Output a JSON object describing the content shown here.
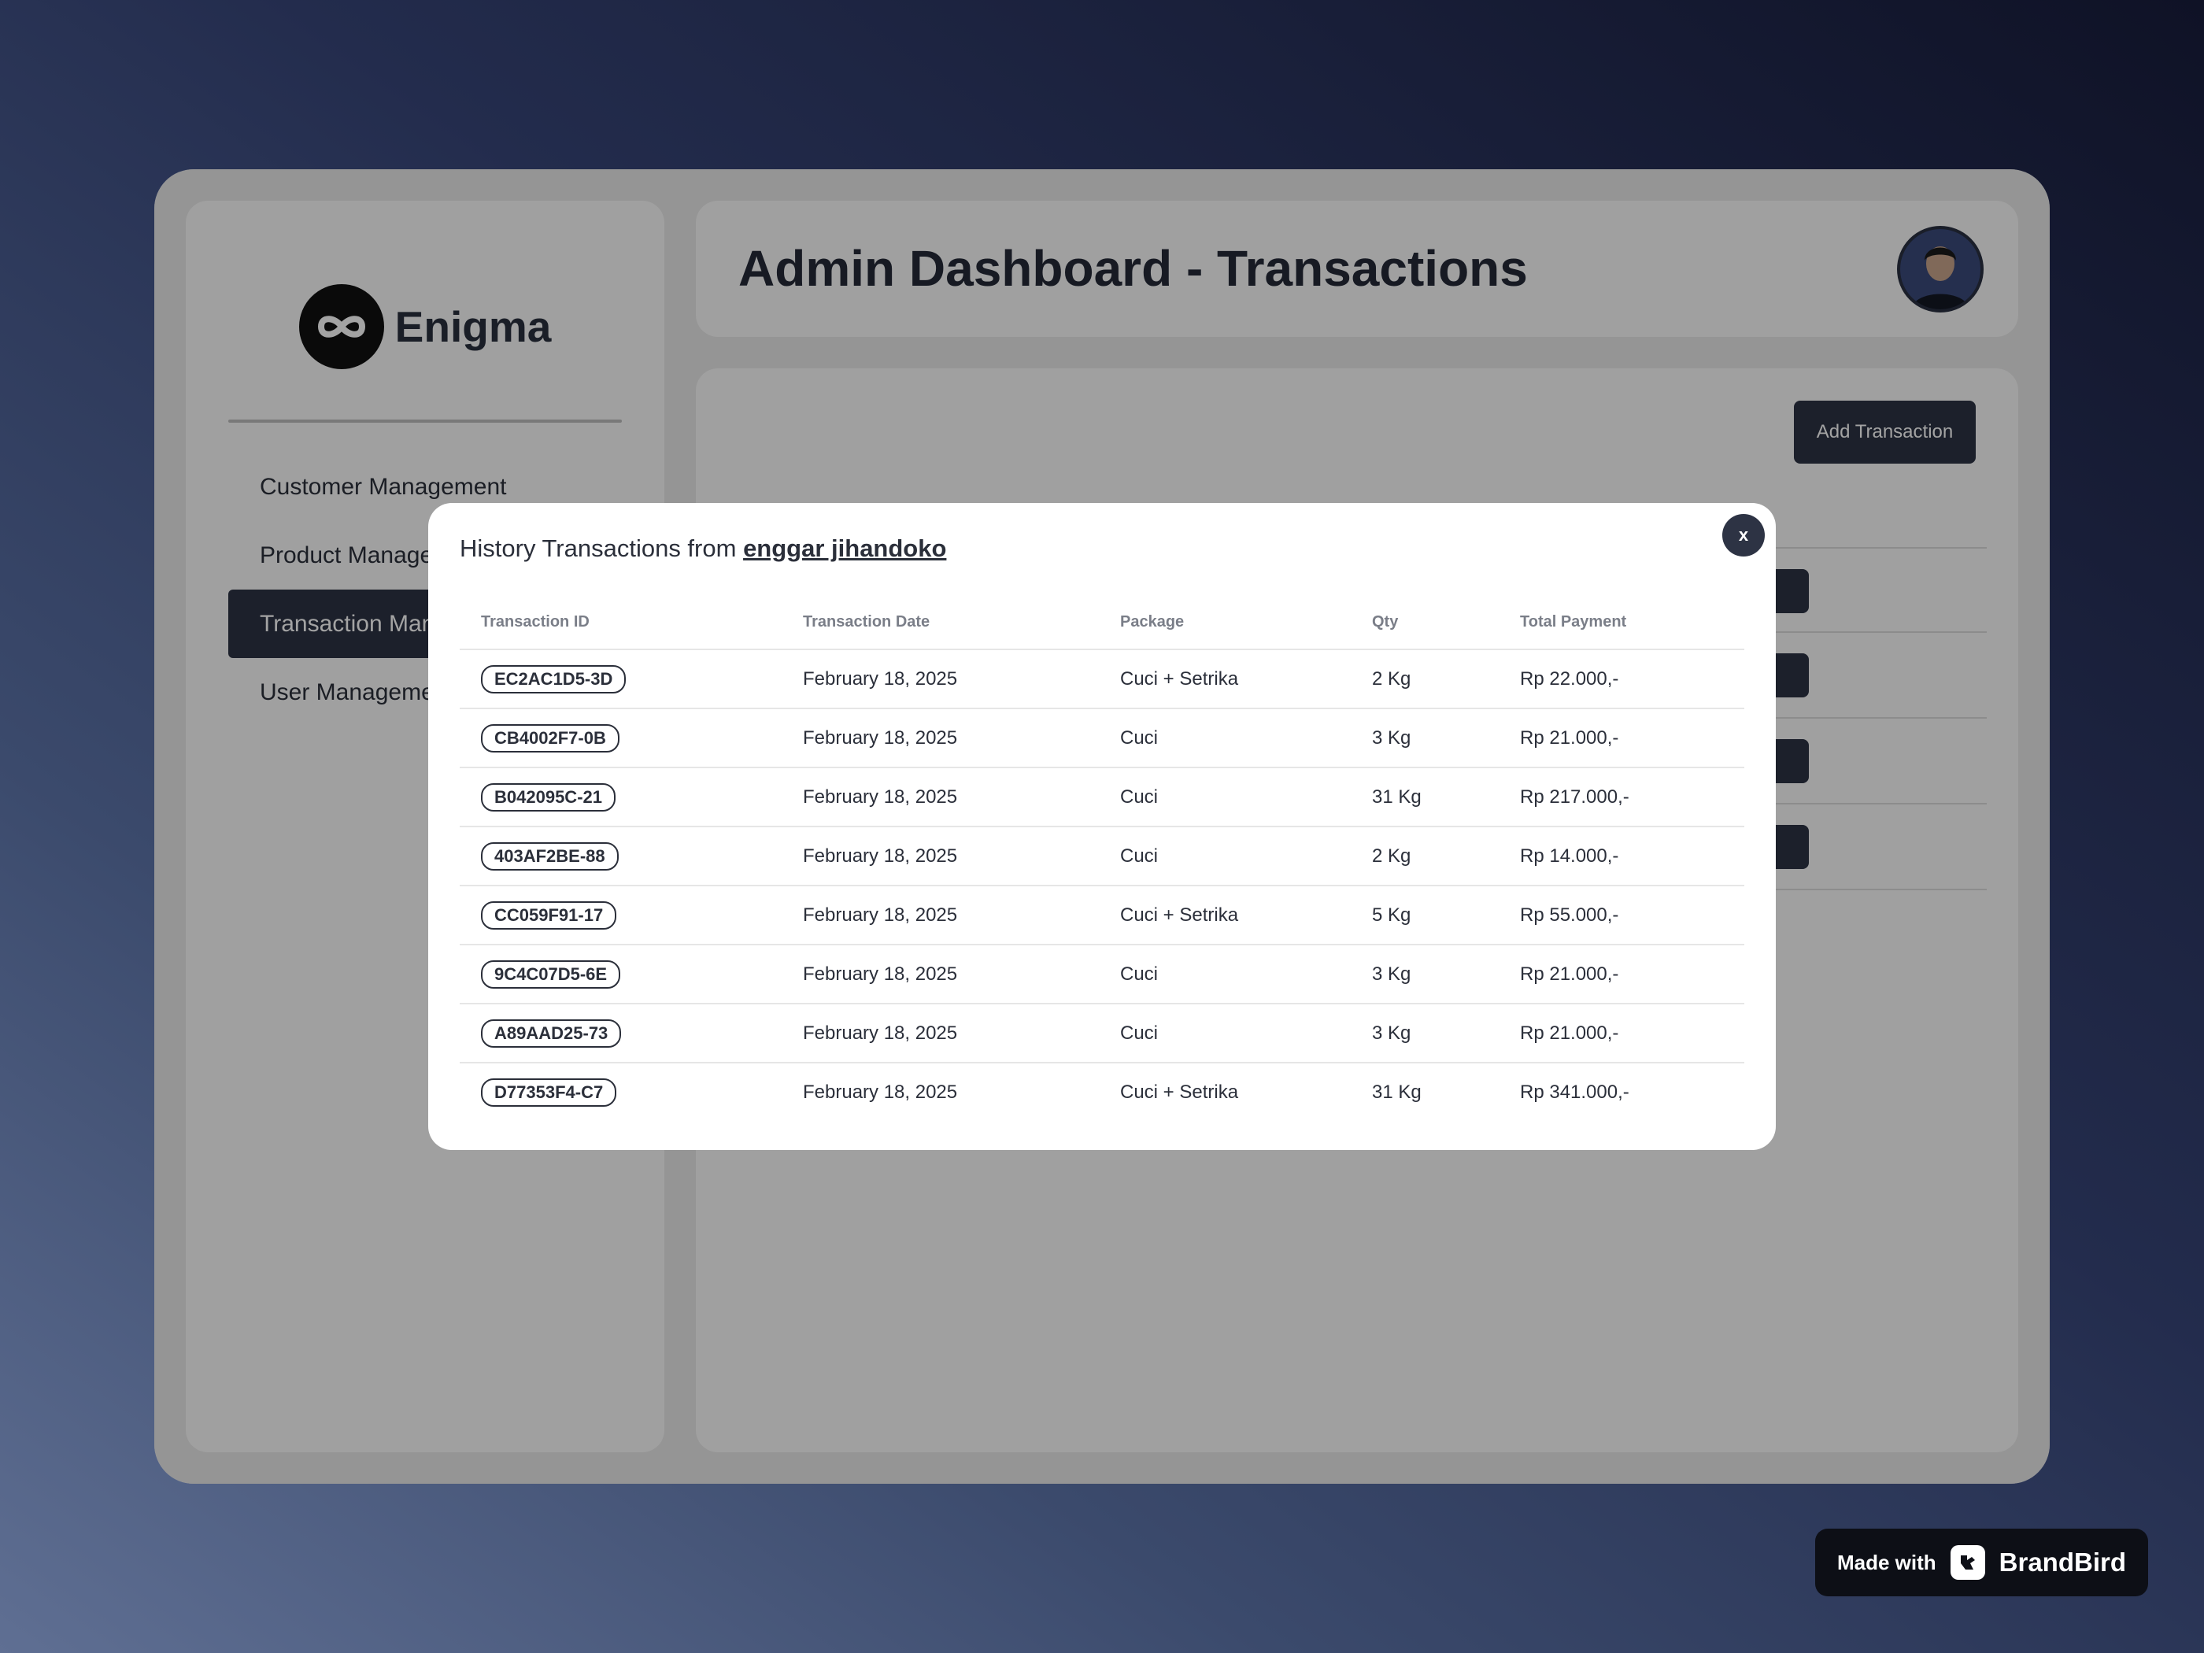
{
  "sidebar": {
    "brand_name": "Enigma",
    "items": [
      {
        "label": "Customer Management"
      },
      {
        "label": "Product Management"
      },
      {
        "label": "Transaction Management"
      },
      {
        "label": "User Management"
      }
    ]
  },
  "header": {
    "title": "Admin Dashboard - Transactions"
  },
  "content": {
    "add_button_label": "Add Transaction"
  },
  "modal": {
    "title_prefix": "History Transactions from",
    "customer_name": "enggar jihandoko",
    "close_label": "x",
    "columns": [
      "Transaction ID",
      "Transaction Date",
      "Package",
      "Qty",
      "Total Payment"
    ],
    "rows": [
      {
        "id": "EC2AC1D5-3D",
        "date": "February 18, 2025",
        "package": "Cuci + Setrika",
        "qty": "2 Kg",
        "total": "Rp 22.000,-"
      },
      {
        "id": "CB4002F7-0B",
        "date": "February 18, 2025",
        "package": "Cuci",
        "qty": "3 Kg",
        "total": "Rp 21.000,-"
      },
      {
        "id": "B042095C-21",
        "date": "February 18, 2025",
        "package": "Cuci",
        "qty": "31 Kg",
        "total": "Rp 217.000,-"
      },
      {
        "id": "403AF2BE-88",
        "date": "February 18, 2025",
        "package": "Cuci",
        "qty": "2 Kg",
        "total": "Rp 14.000,-"
      },
      {
        "id": "CC059F91-17",
        "date": "February 18, 2025",
        "package": "Cuci + Setrika",
        "qty": "5 Kg",
        "total": "Rp 55.000,-"
      },
      {
        "id": "9C4C07D5-6E",
        "date": "February 18, 2025",
        "package": "Cuci",
        "qty": "3 Kg",
        "total": "Rp 21.000,-"
      },
      {
        "id": "A89AAD25-73",
        "date": "February 18, 2025",
        "package": "Cuci",
        "qty": "3 Kg",
        "total": "Rp 21.000,-"
      },
      {
        "id": "D77353F4-C7",
        "date": "February 18, 2025",
        "package": "Cuci + Setrika",
        "qty": "31 Kg",
        "total": "Rp 341.000,-"
      }
    ]
  },
  "watermark": {
    "made_with": "Made with",
    "brand": "BrandBird"
  },
  "colors": {
    "accent_dark": "#2d3344",
    "app_bg": "#e9e9e9",
    "card_bg": "#fafafa",
    "text": "#2b2f3a"
  }
}
